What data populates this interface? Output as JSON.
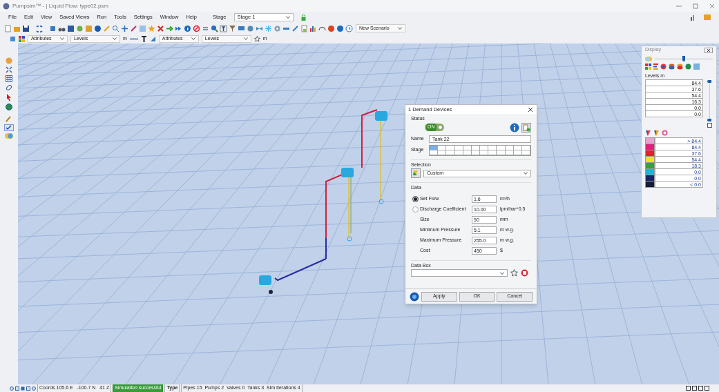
{
  "window": {
    "title": "Pumpsim™ - | Liquid Flow: type02.psm"
  },
  "menu": [
    "File",
    "Edit",
    "View",
    "Saved Views",
    "Run",
    "Tools",
    "Settings",
    "Window",
    "Help"
  ],
  "stage": {
    "label": "Stage",
    "value": "Stage 1"
  },
  "scenario": {
    "value": "New Scenario"
  },
  "toolbar2": {
    "attr1": "Attributes",
    "levels1": "Levels",
    "unit1": "m",
    "attr2": "Attributes",
    "levels2": "Levels",
    "unit2": "m"
  },
  "dialog": {
    "title": "1 Demand Devices",
    "status_label": "Status",
    "status": {
      "label": "ON",
      "on": true
    },
    "name_label": "Name",
    "name": "Tank 22",
    "stage_label": "Stage",
    "stage_cells": [
      {
        "selected": true
      },
      {
        "selected": false
      },
      {
        "selected": false
      },
      {
        "selected": false
      },
      {
        "selected": false
      },
      {
        "selected": false
      },
      {
        "selected": false
      },
      {
        "selected": false
      },
      {
        "selected": false
      },
      {
        "selected": false
      },
      {
        "selected": false
      },
      {
        "selected": false
      }
    ],
    "selection_label": "Selection",
    "selection": "Custom",
    "data_label": "Data",
    "rows": [
      {
        "kind": "radio",
        "selected": true,
        "label": "Set Flow",
        "value": "1.6",
        "unit": "m³/h"
      },
      {
        "kind": "radio",
        "selected": false,
        "label": "Discharge Coefficient",
        "value": "10.00",
        "unit": "lpm/bar^0.5"
      },
      {
        "kind": "plain",
        "label": "Size",
        "value": "50",
        "unit": "mm"
      },
      {
        "kind": "plain",
        "label": "Minimum Pressure",
        "value": "5.1",
        "unit": "m w.g."
      },
      {
        "kind": "plain",
        "label": "Maximum Pressure",
        "value": "255.0",
        "unit": "m w.g."
      },
      {
        "kind": "plain",
        "label": "Cost",
        "value": "450",
        "unit": "$"
      }
    ],
    "databox_label": "Data Box",
    "buttons": [
      "Apply",
      "OK",
      "Cancel"
    ]
  },
  "display": {
    "title": "Display",
    "slider": {
      "level": 0.5
    },
    "levels_label": "Levels m",
    "levels": [
      "84.4",
      "37.6",
      "54.4",
      "16.3",
      "0.0",
      "0.0"
    ],
    "range_top": {
      "level": 1
    },
    "range_bottom": {
      "level": 0
    },
    "checkbox": {
      "checked": false
    },
    "legend": [
      {
        "color": "#e9a0d4",
        "label": "> 84.4"
      },
      {
        "color": "#e0207a",
        "label": "84.4"
      },
      {
        "color": "#e02424",
        "label": "37.6"
      },
      {
        "color": "#f2e21e",
        "label": "54.4"
      },
      {
        "color": "#34a236",
        "label": "18.3"
      },
      {
        "color": "#22b4d4",
        "label": "0.0"
      },
      {
        "color": "#1c2468",
        "label": "0.0"
      },
      {
        "color": "#141c38",
        "label": "< 0.0"
      }
    ]
  },
  "status_bar": {
    "coords": "Coords 105.6 E   -100.7 N   41 Z",
    "sim": "Simulation successful",
    "type": "Type",
    "summary": "Pipes 15  Pumps 2  Valves 0  Tanks 3  Sim Iterations 4"
  }
}
